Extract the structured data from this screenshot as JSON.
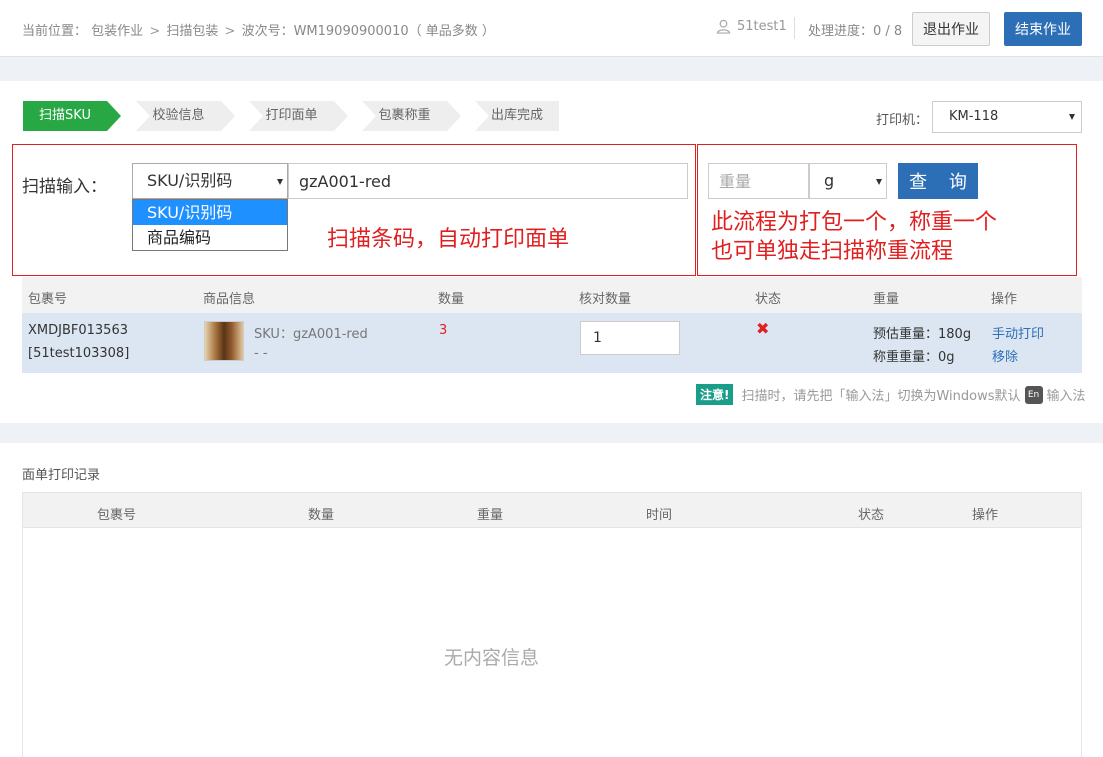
{
  "breadcrumb": {
    "prefix": "当前位置：",
    "items": [
      "包装作业",
      "扫描包装",
      "波次号：WM19090900010（ 单品多数 ）"
    ],
    "separator": ">"
  },
  "header": {
    "user": "51test1",
    "progress": "处理进度：0 / 8",
    "exit_label": "退出作业",
    "end_label": "结束作业"
  },
  "steps": [
    {
      "label": "扫描SKU",
      "active": true
    },
    {
      "label": "校验信息",
      "active": false
    },
    {
      "label": "打印面单",
      "active": false
    },
    {
      "label": "包裹称重",
      "active": false
    },
    {
      "label": "出库完成",
      "active": false
    }
  ],
  "printer": {
    "label": "打印机：",
    "value": "KM-118"
  },
  "scan": {
    "label": "扫描输入：",
    "type_selected": "SKU/识别码",
    "type_options": [
      "SKU/识别码",
      "商品编码"
    ],
    "input_value": "gzA001-red",
    "annotation": "扫描条码，自动打印面单"
  },
  "weigh": {
    "placeholder": "重量",
    "unit": "g",
    "query_label": "查 询",
    "annotation_line1": "此流程为打包一个，称重一个",
    "annotation_line2": "也可单独走扫描称重流程"
  },
  "table1": {
    "headers": [
      "包裹号",
      "商品信息",
      "数量",
      "核对数量",
      "状态",
      "重量",
      "操作"
    ],
    "row": {
      "package_no": "XMDJBF013563",
      "package_sub": "[51test103308]",
      "sku": "SKU：gzA001-red",
      "sku_sub": "- -",
      "quantity": "3",
      "check_qty": "1",
      "est_weight": "预估重量：180g",
      "weighed": "称重重量：0g",
      "action_print": "手动打印",
      "action_remove": "移除"
    }
  },
  "notice": {
    "badge": "注意!",
    "text": "扫描时，请先把「输入法」切换为Windows默认",
    "en": "En",
    "suffix": "输入法"
  },
  "print_log": {
    "title": "面单打印记录",
    "headers": [
      "包裹号",
      "数量",
      "重量",
      "时间",
      "状态",
      "操作"
    ],
    "empty": "无内容信息"
  },
  "colors": {
    "accent": "#2d6fb7",
    "active_step": "#28a745",
    "annotation": "#e02020",
    "row_highlight": "#dbe6f2"
  }
}
